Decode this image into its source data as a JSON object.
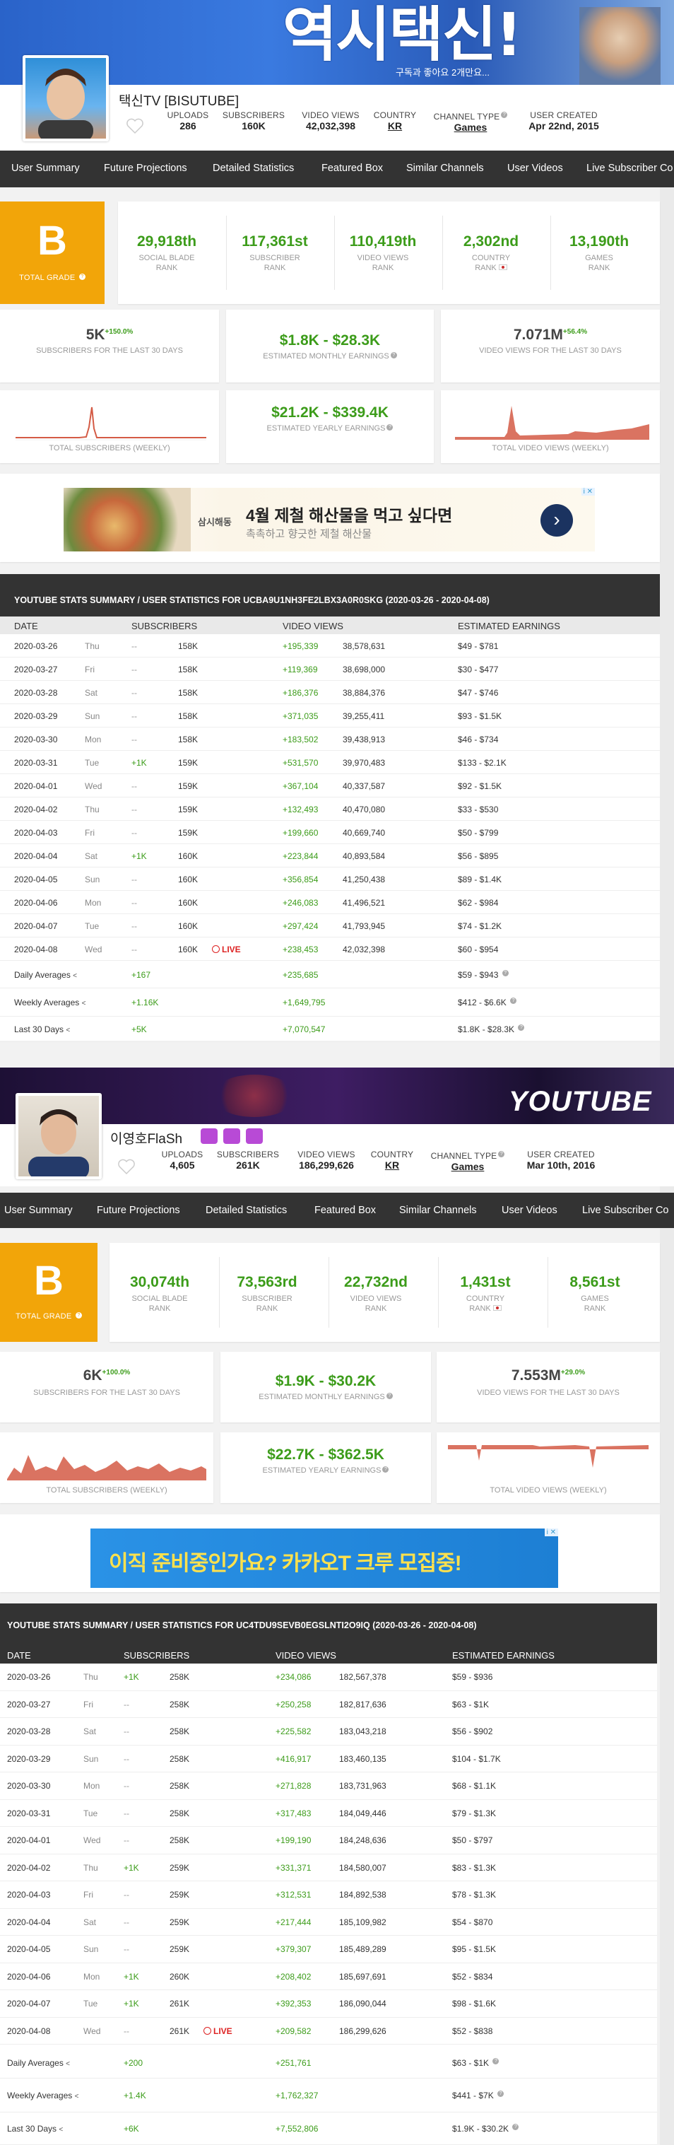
{
  "channels": [
    {
      "banner_text": "역시택신!",
      "banner_sub": "구독과 좋아요 2개만요...",
      "name": "택신TV [BISUTUBE]",
      "uploads_label": "UPLOADS",
      "uploads": "286",
      "subs_label": "SUBSCRIBERS",
      "subs": "160K",
      "views_label": "VIDEO VIEWS",
      "views": "42,032,398",
      "country_label": "COUNTRY",
      "country": "KR",
      "type_label": "CHANNEL TYPE",
      "type": "Games",
      "created_label": "USER CREATED",
      "created": "Apr 22nd, 2015",
      "nav": [
        "User Summary",
        "Future Projections",
        "Detailed Statistics",
        "Featured Box",
        "Similar Channels",
        "User Videos",
        "Live Subscriber Co"
      ],
      "grade": "B",
      "grade_label": "TOTAL GRADE",
      "ranks": [
        {
          "value": "29,918th",
          "label": "SOCIAL BLADE",
          "label2": "RANK"
        },
        {
          "value": "117,361st",
          "label": "SUBSCRIBER",
          "label2": "RANK"
        },
        {
          "value": "110,419th",
          "label": "VIDEO VIEWS",
          "label2": "RANK"
        },
        {
          "value": "2,302nd",
          "label": "COUNTRY",
          "label2": "RANK"
        },
        {
          "value": "13,190th",
          "label": "GAMES",
          "label2": "RANK"
        }
      ],
      "subs30": "5K",
      "subs30_pct": "+150.0%",
      "subs30_label": "SUBSCRIBERS FOR THE LAST 30 DAYS",
      "monthly": "$1.8K - $28.3K",
      "monthly_label": "ESTIMATED MONTHLY EARNINGS",
      "views30": "7.071M",
      "views30_pct": "+56.4%",
      "views30_label": "VIDEO VIEWS FOR THE LAST 30 DAYS",
      "subs_weekly_label": "TOTAL SUBSCRIBERS (WEEKLY)",
      "yearly": "$21.2K - $339.4K",
      "yearly_label": "ESTIMATED YEARLY EARNINGS",
      "views_weekly_label": "TOTAL VIDEO VIEWS (WEEKLY)",
      "ad": {
        "brand": "삼시해동",
        "headline": "4월 제철 해산물을 먹고 싶다면",
        "sub": "촉촉하고 향긋한 제철 해산물",
        "badge": "i ✕"
      },
      "table_title": "YOUTUBE STATS SUMMARY / USER STATISTICS FOR UCBA9U1NH3FE2LBX3A0R0SKG (2020-03-26 - 2020-04-08)",
      "cols": [
        "DATE",
        "SUBSCRIBERS",
        "VIDEO VIEWS",
        "ESTIMATED EARNINGS"
      ],
      "rows": [
        [
          "2020-03-26",
          "Thu",
          "--",
          "158K",
          "+195,339",
          "38,578,631",
          "$49 - $781"
        ],
        [
          "2020-03-27",
          "Fri",
          "--",
          "158K",
          "+119,369",
          "38,698,000",
          "$30 - $477"
        ],
        [
          "2020-03-28",
          "Sat",
          "--",
          "158K",
          "+186,376",
          "38,884,376",
          "$47 - $746"
        ],
        [
          "2020-03-29",
          "Sun",
          "--",
          "158K",
          "+371,035",
          "39,255,411",
          "$93 - $1.5K"
        ],
        [
          "2020-03-30",
          "Mon",
          "--",
          "158K",
          "+183,502",
          "39,438,913",
          "$46 - $734"
        ],
        [
          "2020-03-31",
          "Tue",
          "+1K",
          "159K",
          "+531,570",
          "39,970,483",
          "$133 - $2.1K"
        ],
        [
          "2020-04-01",
          "Wed",
          "--",
          "159K",
          "+367,104",
          "40,337,587",
          "$92 - $1.5K"
        ],
        [
          "2020-04-02",
          "Thu",
          "--",
          "159K",
          "+132,493",
          "40,470,080",
          "$33 - $530"
        ],
        [
          "2020-04-03",
          "Fri",
          "--",
          "159K",
          "+199,660",
          "40,669,740",
          "$50 - $799"
        ],
        [
          "2020-04-04",
          "Sat",
          "+1K",
          "160K",
          "+223,844",
          "40,893,584",
          "$56 - $895"
        ],
        [
          "2020-04-05",
          "Sun",
          "--",
          "160K",
          "+356,854",
          "41,250,438",
          "$89 - $1.4K"
        ],
        [
          "2020-04-06",
          "Mon",
          "--",
          "160K",
          "+246,083",
          "41,496,521",
          "$62 - $984"
        ],
        [
          "2020-04-07",
          "Tue",
          "--",
          "160K",
          "+297,424",
          "41,793,945",
          "$74 - $1.2K"
        ],
        [
          "2020-04-08",
          "Wed",
          "--",
          "160K",
          "+238,453",
          "42,032,398",
          "$60 - $954"
        ]
      ],
      "live": "LIVE",
      "summary": [
        {
          "label": "Daily Averages",
          "subs": "+167",
          "views": "+235,685",
          "earn": "$59 - $943"
        },
        {
          "label": "Weekly Averages",
          "subs": "+1.16K",
          "views": "+1,649,795",
          "earn": "$412 - $6.6K"
        },
        {
          "label": "Last 30 Days",
          "subs": "+5K",
          "views": "+7,070,547",
          "earn": "$1.8K - $28.3K"
        }
      ]
    },
    {
      "banner_text": "YOUTUBE",
      "name": "이영호FlaSh",
      "uploads_label": "UPLOADS",
      "uploads": "4,605",
      "subs_label": "SUBSCRIBERS",
      "subs": "261K",
      "views_label": "VIDEO VIEWS",
      "views": "186,299,626",
      "country_label": "COUNTRY",
      "country": "KR",
      "type_label": "CHANNEL TYPE",
      "type": "Games",
      "created_label": "USER CREATED",
      "created": "Mar 10th, 2016",
      "nav": [
        "User Summary",
        "Future Projections",
        "Detailed Statistics",
        "Featured Box",
        "Similar Channels",
        "User Videos",
        "Live Subscriber Co"
      ],
      "grade": "B",
      "grade_label": "TOTAL GRADE",
      "ranks": [
        {
          "value": "30,074th",
          "label": "SOCIAL BLADE",
          "label2": "RANK"
        },
        {
          "value": "73,563rd",
          "label": "SUBSCRIBER",
          "label2": "RANK"
        },
        {
          "value": "22,732nd",
          "label": "VIDEO VIEWS",
          "label2": "RANK"
        },
        {
          "value": "1,431st",
          "label": "COUNTRY",
          "label2": "RANK"
        },
        {
          "value": "8,561st",
          "label": "GAMES",
          "label2": "RANK"
        }
      ],
      "subs30": "6K",
      "subs30_pct": "+100.0%",
      "subs30_label": "SUBSCRIBERS FOR THE LAST 30 DAYS",
      "monthly": "$1.9K - $30.2K",
      "monthly_label": "ESTIMATED MONTHLY EARNINGS",
      "views30": "7.553M",
      "views30_pct": "+29.0%",
      "views30_label": "VIDEO VIEWS FOR THE LAST 30 DAYS",
      "subs_weekly_label": "TOTAL SUBSCRIBERS (WEEKLY)",
      "yearly": "$22.7K - $362.5K",
      "yearly_label": "ESTIMATED YEARLY EARNINGS",
      "views_weekly_label": "TOTAL VIDEO VIEWS (WEEKLY)",
      "ad": {
        "headline": "이직 준비중인가요? 카카오T 크루 모집중!",
        "badge": "i ✕"
      },
      "table_title": "YOUTUBE STATS SUMMARY / USER STATISTICS FOR UC4TDU9SEVB0EGSLNTI2O9IQ (2020-03-26 - 2020-04-08)",
      "cols": [
        "DATE",
        "SUBSCRIBERS",
        "VIDEO VIEWS",
        "ESTIMATED EARNINGS"
      ],
      "rows": [
        [
          "2020-03-26",
          "Thu",
          "+1K",
          "258K",
          "+234,086",
          "182,567,378",
          "$59 - $936"
        ],
        [
          "2020-03-27",
          "Fri",
          "--",
          "258K",
          "+250,258",
          "182,817,636",
          "$63 - $1K"
        ],
        [
          "2020-03-28",
          "Sat",
          "--",
          "258K",
          "+225,582",
          "183,043,218",
          "$56 - $902"
        ],
        [
          "2020-03-29",
          "Sun",
          "--",
          "258K",
          "+416,917",
          "183,460,135",
          "$104 - $1.7K"
        ],
        [
          "2020-03-30",
          "Mon",
          "--",
          "258K",
          "+271,828",
          "183,731,963",
          "$68 - $1.1K"
        ],
        [
          "2020-03-31",
          "Tue",
          "--",
          "258K",
          "+317,483",
          "184,049,446",
          "$79 - $1.3K"
        ],
        [
          "2020-04-01",
          "Wed",
          "--",
          "258K",
          "+199,190",
          "184,248,636",
          "$50 - $797"
        ],
        [
          "2020-04-02",
          "Thu",
          "+1K",
          "259K",
          "+331,371",
          "184,580,007",
          "$83 - $1.3K"
        ],
        [
          "2020-04-03",
          "Fri",
          "--",
          "259K",
          "+312,531",
          "184,892,538",
          "$78 - $1.3K"
        ],
        [
          "2020-04-04",
          "Sat",
          "--",
          "259K",
          "+217,444",
          "185,109,982",
          "$54 - $870"
        ],
        [
          "2020-04-05",
          "Sun",
          "--",
          "259K",
          "+379,307",
          "185,489,289",
          "$95 - $1.5K"
        ],
        [
          "2020-04-06",
          "Mon",
          "+1K",
          "260K",
          "+208,402",
          "185,697,691",
          "$52 - $834"
        ],
        [
          "2020-04-07",
          "Tue",
          "+1K",
          "261K",
          "+392,353",
          "186,090,044",
          "$98 - $1.6K"
        ],
        [
          "2020-04-08",
          "Wed",
          "--",
          "261K",
          "+209,582",
          "186,299,626",
          "$52 - $838"
        ]
      ],
      "live": "LIVE",
      "summary": [
        {
          "label": "Daily Averages",
          "subs": "+200",
          "views": "+251,761",
          "earn": "$63 - $1K"
        },
        {
          "label": "Weekly Averages",
          "subs": "+1.4K",
          "views": "+1,762,327",
          "earn": "$441 - $7K"
        },
        {
          "label": "Last 30 Days",
          "subs": "+6K",
          "views": "+7,552,806",
          "earn": "$1.9K - $30.2K"
        }
      ]
    }
  ]
}
